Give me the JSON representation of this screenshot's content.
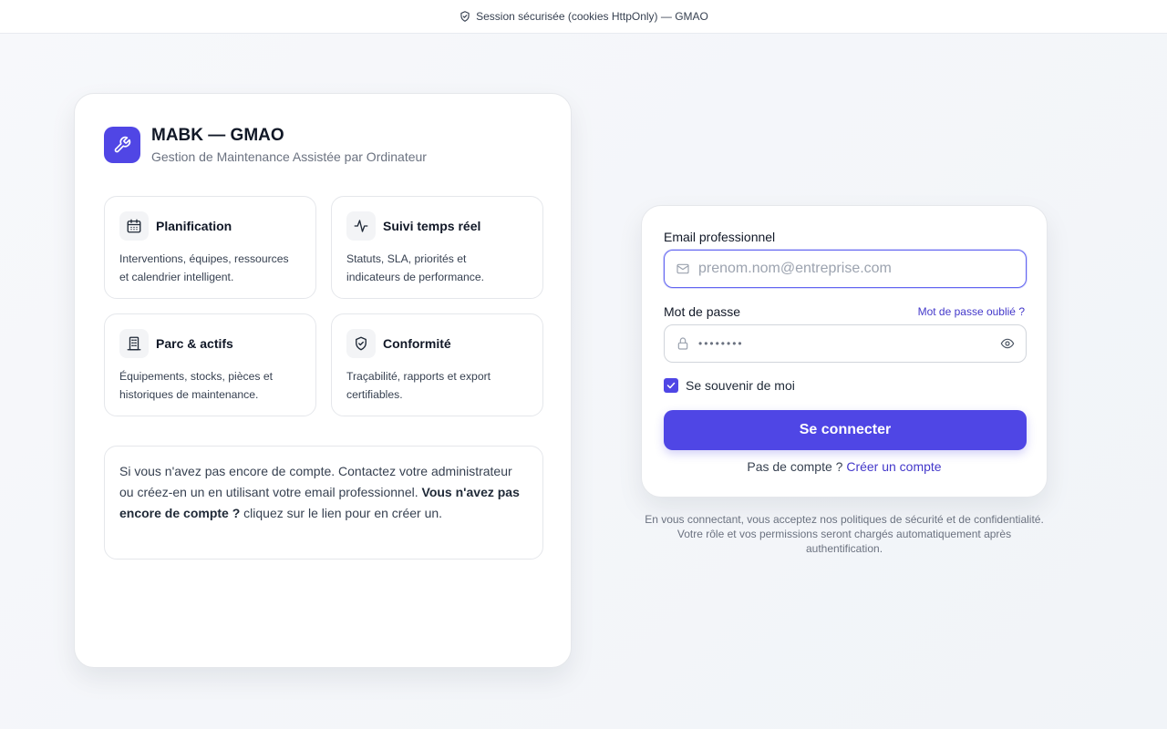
{
  "topbar": {
    "text": "Session sécurisée (cookies HttpOnly) — GMAO",
    "icon": "shield-check-icon"
  },
  "brand": {
    "title": "MABK — GMAO",
    "subtitle": "Gestion de Maintenance Assistée par Ordinateur",
    "icon": "wrench-icon",
    "accent": "#5046e5"
  },
  "features": [
    {
      "title": "Planification",
      "desc1": "Interventions, équipes, ressources",
      "desc2": "et calendrier intelligent.",
      "icon": "calendar-icon"
    },
    {
      "title": "Suivi temps réel",
      "desc1": "Statuts, SLA, priorités et",
      "desc2": "indicateurs de performance.",
      "icon": "activity-icon"
    },
    {
      "title": "Parc & actifs",
      "desc1": "Équipements, stocks, pièces et",
      "desc2": "historiques de maintenance.",
      "icon": "building-icon"
    },
    {
      "title": "Conformité",
      "desc1": "Traçabilité, rapports et export",
      "desc2": "certifiables.",
      "icon": "shield-check-icon"
    }
  ],
  "info": {
    "text": "Si vous n'avez pas encore de compte. Contactez votre administrateur ou créez-en un en utilisant votre email professionnel.",
    "bold": "Vous n'avez pas encore de compte ?",
    "rest": "cliquez sur le lien pour en créer un."
  },
  "login": {
    "email_label": "Email professionnel",
    "email_placeholder": "prenom.nom@entreprise.com",
    "password_label": "Mot de passe",
    "forgot_label": "Mot de passe oublié ?",
    "password_value": "••••••••",
    "remember_label": "Se souvenir de moi",
    "remember_checked": true,
    "submit_label": "Se connecter",
    "signup_prompt": "Pas de compte ?",
    "signup_link": "Créer un compte",
    "accent": "#4f46e5"
  },
  "legal": "En vous connectant, vous acceptez nos politiques de sécurité et de confidentialité. Votre rôle et vos permissions seront chargés automatiquement après authentification."
}
